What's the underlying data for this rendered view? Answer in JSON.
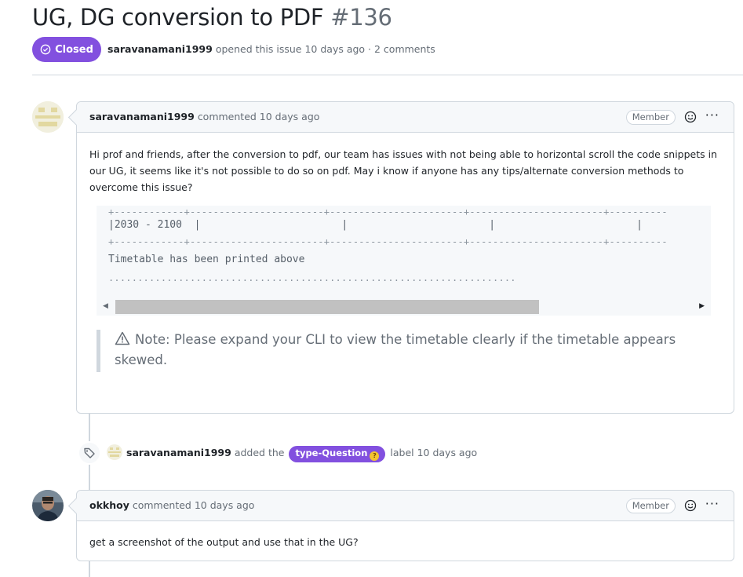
{
  "issue": {
    "title": "UG, DG conversion to PDF",
    "number": "#136",
    "state": "Closed",
    "author": "saravanamani1999",
    "meta_rest": "opened this issue 10 days ago · 2 comments"
  },
  "comments": [
    {
      "author": "saravanamani1999",
      "action": "commented 10 days ago",
      "role": "Member",
      "body": "Hi prof and friends, after the conversion to pdf, our team has issues with not being able to horizontal scroll the code snippets in our UG, it seems like it's not possible to do so on pdf. May i know if anyone has any tips/alternate conversion methods to overcome this issue?",
      "code_lines": [
        "+------------+-----------------------+-----------------------+-----------------------+----------",
        "|2030 - 2100  |                       |                       |                       |",
        "+------------+-----------------------+-----------------------+-----------------------+----------",
        "Timetable has been printed above",
        "......................................................................"
      ],
      "note": "Note: Please expand your CLI to view the timetable clearly if the timetable appears skewed."
    },
    {
      "author": "okkhoy",
      "action": "commented 10 days ago",
      "role": "Member",
      "body": "get a screenshot of the output and use that in the UG?"
    }
  ],
  "event": {
    "actor": "saravanamani1999",
    "verb": "added the",
    "label": "type-Question",
    "suffix": "label 10 days ago"
  },
  "icons": {
    "state": "circle-check-icon",
    "emoji": "smiley-icon",
    "more": "kebab-horizontal-icon",
    "tag": "tag-icon",
    "warning": "warning-icon"
  },
  "colors": {
    "closed": "#8250df",
    "label": "#8250df"
  }
}
